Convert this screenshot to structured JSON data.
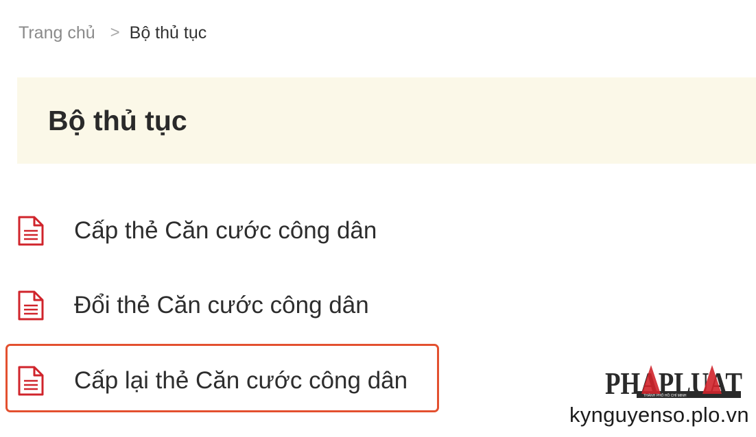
{
  "breadcrumb": {
    "home": "Trang chủ",
    "separator": ">",
    "current": "Bộ thủ tục"
  },
  "page_title": "Bộ thủ tục",
  "procedures": [
    {
      "label": "Cấp thẻ Căn cước công dân",
      "icon": "document-icon"
    },
    {
      "label": "Đổi thẻ Căn cước công dân",
      "icon": "document-icon"
    },
    {
      "label": "Cấp lại thẻ Căn cước công dân",
      "icon": "document-icon",
      "highlighted": true
    }
  ],
  "watermark": {
    "logo": "PHAPLUAT",
    "logo_subtitle": "THÀNH PHỐ HỒ CHÍ MINH",
    "site": "kynguyenso.plo.vn"
  },
  "colors": {
    "icon_red": "#d0242b",
    "title_background": "#fbf8e8",
    "highlight_border": "#e3502f"
  }
}
